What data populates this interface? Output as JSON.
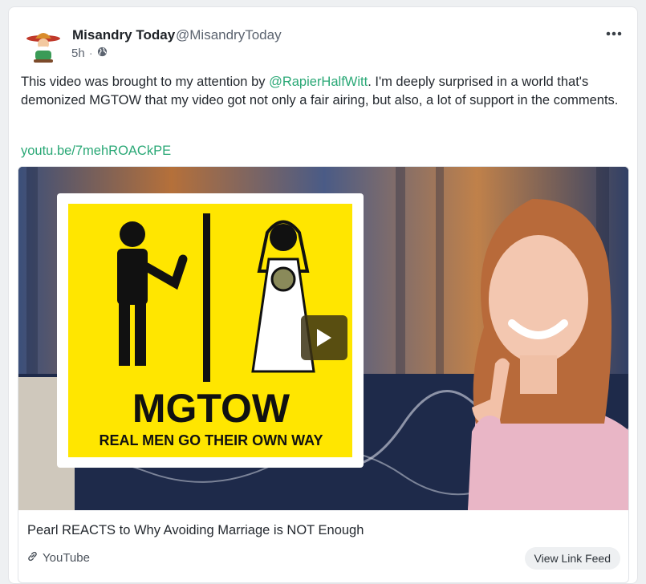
{
  "post": {
    "author_name": "Misandry Today",
    "author_handle": "@MisandryToday",
    "time_ago": "5h",
    "separator": "·",
    "visibility_icon": "globe-icon",
    "more_icon": "more-icon",
    "text_before": "This video was brought to my attention by ",
    "mention": "@RapierHalfWitt",
    "text_after": ". I'm deeply surprised in a world that's demonized MGTOW that my video got not only a fair airing, but also, a lot of support in the comments.",
    "link": "youtu.be/7mehROACkPE"
  },
  "embed": {
    "thumbnail_heading": "MGTOW",
    "thumbnail_subheading": "REAL MEN GO THEIR OWN WAY",
    "play_icon": "play-icon",
    "title": "Pearl REACTS to Why Avoiding Marriage is NOT Enough",
    "source": "YouTube",
    "source_icon": "link-icon",
    "view_feed_label": "View Link Feed"
  },
  "colors": {
    "accent": "#2aa876",
    "thumbnail_yellow": "#ffe600"
  }
}
